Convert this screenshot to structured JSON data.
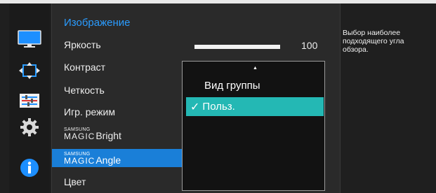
{
  "menu": {
    "title": "Изображение",
    "items": [
      {
        "label": "Яркость"
      },
      {
        "label": "Контраст"
      },
      {
        "label": "Четкость"
      },
      {
        "label": "Игр. режим"
      },
      {
        "samsung": "SAMSUNG",
        "magic": "MAGIC",
        "suffix": "Bright"
      },
      {
        "samsung": "SAMSUNG",
        "magic": "MAGIC",
        "suffix": "Angle"
      },
      {
        "label": "Цвет"
      }
    ],
    "selected_index": 5
  },
  "brightness_slider": {
    "value": "100",
    "fraction": 1.0
  },
  "dropdown": {
    "arrow": "▲",
    "options": [
      {
        "label": "Вид группы",
        "checked": false
      },
      {
        "label": "Польз.",
        "checked": true
      }
    ],
    "check_glyph": "✓"
  },
  "help_text": "Выбор наиболее подходящего угла обзора.",
  "icons": [
    "monitor-icon",
    "position-arrows-icon",
    "settings-sliders-icon",
    "gear-icon",
    "info-icon"
  ],
  "colors": {
    "accent_blue": "#2a9cff",
    "selected_bg": "#1a7fd8",
    "checked_bg": "#24b8b4"
  }
}
